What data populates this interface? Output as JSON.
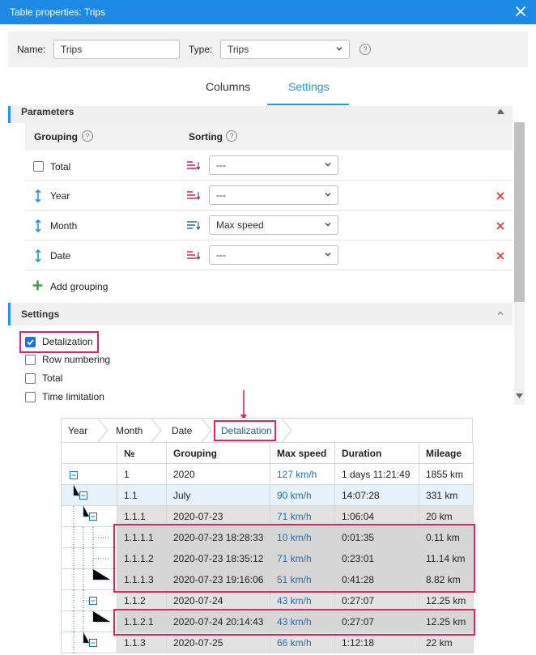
{
  "dialog": {
    "title": "Table properties: Trips",
    "name_label": "Name:",
    "name_value": "Trips",
    "type_label": "Type:",
    "type_value": "Trips",
    "help_glyph": "?",
    "tabs": [
      {
        "label": "Columns"
      },
      {
        "label": "Settings"
      }
    ],
    "active_tab": "Settings"
  },
  "parameters": {
    "title": "Parameters",
    "grouping_label": "Grouping",
    "sorting_label": "Sorting",
    "rows": [
      {
        "label": "Total",
        "sort": "---",
        "checked": false
      },
      {
        "label": "Year",
        "sort": "---"
      },
      {
        "label": "Month",
        "sort": "Max speed"
      },
      {
        "label": "Date",
        "sort": "---"
      }
    ],
    "add_label": "Add grouping"
  },
  "settings": {
    "title": "Settings",
    "options": [
      {
        "label": "Detalization",
        "checked": true
      },
      {
        "label": "Row numbering",
        "checked": false
      },
      {
        "label": "Total",
        "checked": false
      },
      {
        "label": "Time limitation",
        "checked": false
      }
    ]
  },
  "breadcrumb": [
    "Year",
    "Month",
    "Date",
    "Detalization"
  ],
  "table": {
    "headers": [
      "",
      "№",
      "Grouping",
      "Max speed",
      "Duration",
      "Mileage"
    ],
    "rows": [
      {
        "num": "1",
        "grouping": "2020",
        "speed": "127 km/h",
        "duration": "1 days 11:21:49",
        "mileage": "1855 km"
      },
      {
        "num": "1.1",
        "grouping": "July",
        "speed": "90 km/h",
        "duration": "14:07:28",
        "mileage": "331 km"
      },
      {
        "num": "1.1.1",
        "grouping": "2020-07-23",
        "speed": "71 km/h",
        "duration": "1:06:04",
        "mileage": "20 km"
      },
      {
        "num": "1.1.1.1",
        "grouping": "2020-07-23 18:28:33",
        "speed": "10 km/h",
        "duration": "0:01:35",
        "mileage": "0.11 km"
      },
      {
        "num": "1.1.1.2",
        "grouping": "2020-07-23 18:35:12",
        "speed": "71 km/h",
        "duration": "0:23:01",
        "mileage": "11.14 km"
      },
      {
        "num": "1.1.1.3",
        "grouping": "2020-07-23 19:16:06",
        "speed": "51 km/h",
        "duration": "0:41:28",
        "mileage": "8.82 km"
      },
      {
        "num": "1.1.2",
        "grouping": "2020-07-24",
        "speed": "43 km/h",
        "duration": "0:27:07",
        "mileage": "12.25 km"
      },
      {
        "num": "1.1.2.1",
        "grouping": "2020-07-24 20:14:43",
        "speed": "43 km/h",
        "duration": "0:27:07",
        "mileage": "12.25 km"
      },
      {
        "num": "1.1.3",
        "grouping": "2020-07-25",
        "speed": "66 km/h",
        "duration": "1:12:18",
        "mileage": "22 km"
      }
    ]
  },
  "colors": {
    "accent": "#1e88e5",
    "highlight": "#e0245e",
    "delete": "#e53935",
    "add": "#43a047"
  },
  "icons": [
    "close-icon",
    "chevron-down-icon",
    "help-icon",
    "sort-desc-icon",
    "sort-lines-icon",
    "move-vertical-icon",
    "delete-icon",
    "plus-icon",
    "collapse-icon",
    "check-icon",
    "arrow-down-icon"
  ]
}
